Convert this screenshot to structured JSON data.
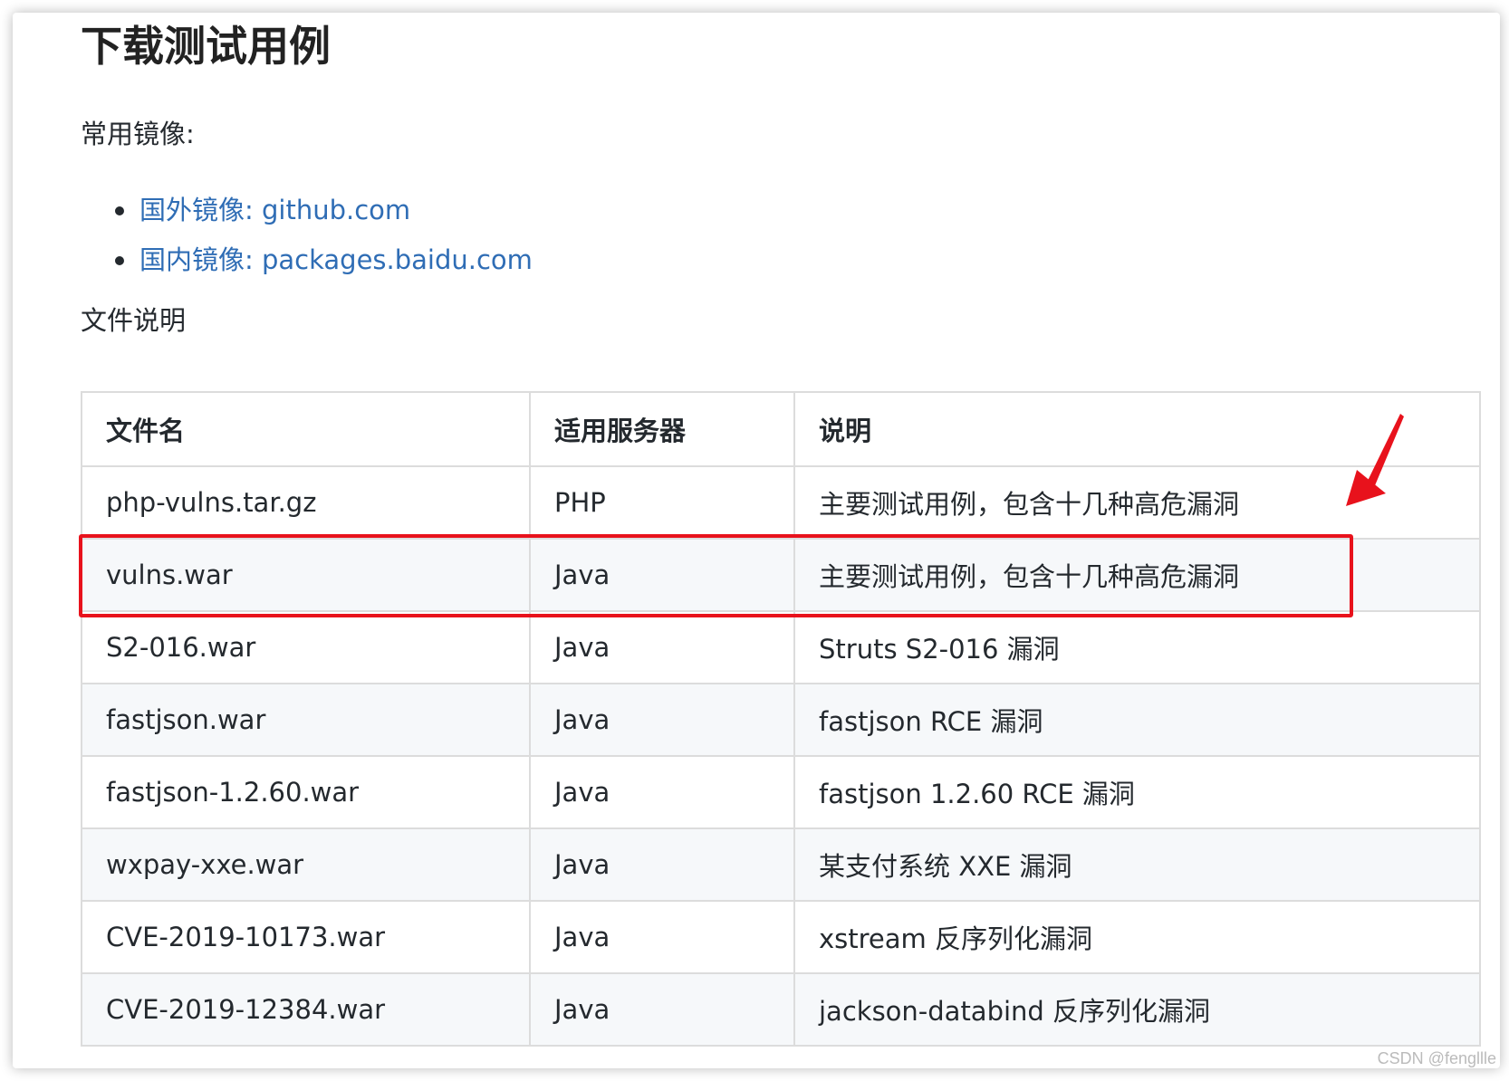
{
  "heading": "下载测试用例",
  "mirrors_label": "常用镜像:",
  "mirrors": [
    {
      "label": "国外镜像: github.com"
    },
    {
      "label": "国内镜像: packages.baidu.com"
    }
  ],
  "files_label": "文件说明",
  "table": {
    "headers": [
      "文件名",
      "适用服务器",
      "说明"
    ],
    "rows": [
      [
        "php-vulns.tar.gz",
        "PHP",
        "主要测试用例，包含十几种高危漏洞"
      ],
      [
        "vulns.war",
        "Java",
        "主要测试用例，包含十几种高危漏洞"
      ],
      [
        "S2-016.war",
        "Java",
        "Struts S2-016 漏洞"
      ],
      [
        "fastjson.war",
        "Java",
        "fastjson RCE 漏洞"
      ],
      [
        "fastjson-1.2.60.war",
        "Java",
        "fastjson 1.2.60 RCE 漏洞"
      ],
      [
        "wxpay-xxe.war",
        "Java",
        "某支付系统 XXE 漏洞"
      ],
      [
        "CVE-2019-10173.war",
        "Java",
        "xstream 反序列化漏洞"
      ],
      [
        "CVE-2019-12384.war",
        "Java",
        "jackson-databind 反序列化漏洞"
      ]
    ]
  },
  "annotation": {
    "highlight_color": "#e8121c",
    "highlighted_row": "vulns.war",
    "arrow_icon": "red-arrow-icon"
  },
  "colors": {
    "link": "#2f6db5",
    "border": "#dcdcdc",
    "stripe": "#f6f8fa"
  },
  "watermark": "CSDN @fengllle"
}
